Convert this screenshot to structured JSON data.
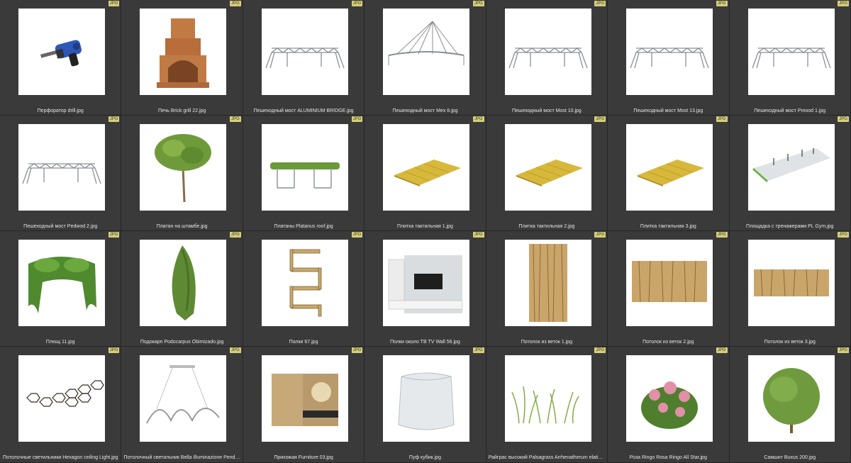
{
  "browser": {
    "badge_label": "JPG",
    "items": [
      {
        "name": "Перфоратор drill.jpg",
        "icon": "drill"
      },
      {
        "name": "Печь Brick grill 22.jpg",
        "icon": "brick-oven"
      },
      {
        "name": "Пешеходный мост ALUMINIUM BRIDGE.jpg",
        "icon": "bridge"
      },
      {
        "name": "Пешеходный мост Mex 8.jpg",
        "icon": "cable-bridge"
      },
      {
        "name": "Пешеходный мост Most 10.jpg",
        "icon": "bridge"
      },
      {
        "name": "Пешеходный мост Most 13.jpg",
        "icon": "bridge"
      },
      {
        "name": "Пешеходный мост Pmood 1.jpg",
        "icon": "bridge"
      },
      {
        "name": "Пешеходный мост Pedwod 2.jpg",
        "icon": "bridge"
      },
      {
        "name": "Платан на штамбе.jpg",
        "icon": "standard-tree"
      },
      {
        "name": "Платаны Platanus roof.jpg",
        "icon": "tree-roof"
      },
      {
        "name": "Плитка тактильная 1.jpg",
        "icon": "tile"
      },
      {
        "name": "Плитка тактильная 2.jpg",
        "icon": "tile"
      },
      {
        "name": "Плитка тактильная 3.jpg",
        "icon": "tile"
      },
      {
        "name": "Площадка с тренажерами PL Gym.jpg",
        "icon": "gym-platform"
      },
      {
        "name": "Плющ 11.jpg",
        "icon": "ivy"
      },
      {
        "name": "Подокарп Podocarpus Obimizado.jpg",
        "icon": "conifer"
      },
      {
        "name": "Полки 67.jpg",
        "icon": "shelves"
      },
      {
        "name": "Полки около ТВ TV Wall 56.jpg",
        "icon": "tv-wall"
      },
      {
        "name": "Потолок из веток 1.jpg",
        "icon": "branch-panel-tall"
      },
      {
        "name": "Потолок из веток 2.jpg",
        "icon": "branch-panel-wide"
      },
      {
        "name": "Потолок из веток 3.jpg",
        "icon": "branch-panel-thin"
      },
      {
        "name": "Потолочные светильники Hexagon ceiling Light.jpg",
        "icon": "hexagon-light"
      },
      {
        "name": "Потолочный светильник Bella Illuminazione Pendente Spirale.jpg",
        "icon": "pendant-light"
      },
      {
        "name": "Прихожая Furniture 03.jpg",
        "icon": "hallway-furniture"
      },
      {
        "name": "Пуф кубик.jpg",
        "icon": "pouf"
      },
      {
        "name": "Райграс высокий Palsagrass Arrhenatherum elatius.jpg",
        "icon": "grass"
      },
      {
        "name": "Роза Ringo Rosa Ringo All Star.jpg",
        "icon": "rose-bush"
      },
      {
        "name": "Самшит Buxus 200.jpg",
        "icon": "buxus-tree"
      }
    ]
  }
}
